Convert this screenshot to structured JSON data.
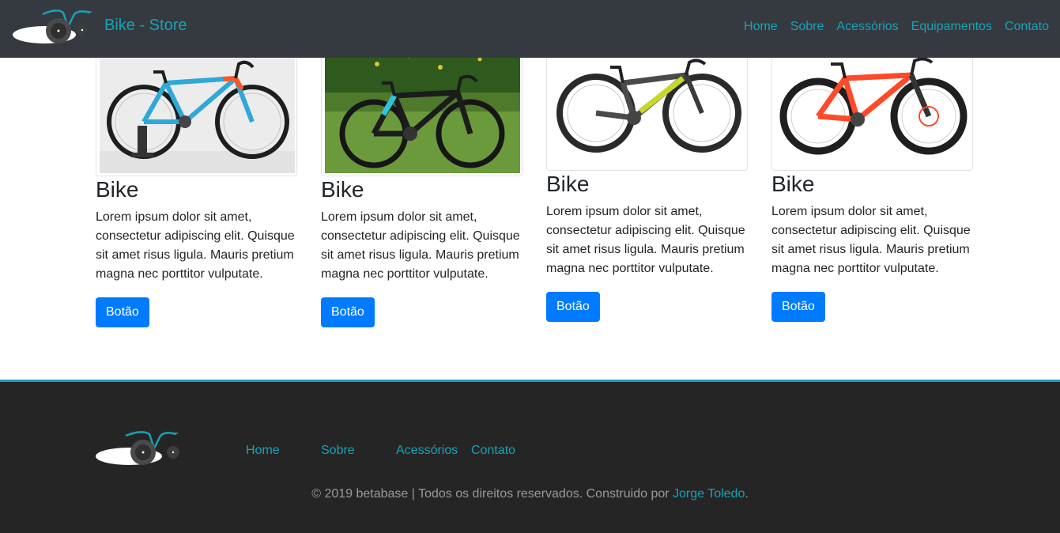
{
  "header": {
    "brand": "Bike - Store",
    "nav": [
      "Home",
      "Sobre",
      "Acessórios",
      "Equipamentos",
      "Contato"
    ]
  },
  "products": [
    {
      "title": "Bike",
      "description": "Lorem ipsum dolor sit amet, consectetur adipiscing elit. Quisque sit amet risus ligula. Mauris pretium magna nec porttitor vulputate.",
      "button": "Botão"
    },
    {
      "title": "Bike",
      "description": "Lorem ipsum dolor sit amet, consectetur adipiscing elit. Quisque sit amet risus ligula. Mauris pretium magna nec porttitor vulputate.",
      "button": "Botão"
    },
    {
      "title": "Bike",
      "description": "Lorem ipsum dolor sit amet, consectetur adipiscing elit. Quisque sit amet risus ligula. Mauris pretium magna nec porttitor vulputate.",
      "button": "Botão"
    },
    {
      "title": "Bike",
      "description": "Lorem ipsum dolor sit amet, consectetur adipiscing elit. Quisque sit amet risus ligula. Mauris pretium magna nec porttitor vulputate.",
      "button": "Botão"
    }
  ],
  "footer": {
    "nav": [
      "Home",
      "Sobre",
      "Acessórios",
      "Contato"
    ],
    "copyright_prefix": "© 2019 betabase | Todos os direitos reservados. Construido por ",
    "author": "Jorge Toledo",
    "copyright_suffix": "."
  },
  "colors": {
    "navbar_bg": "#343a40",
    "accent": "#17a2b8",
    "button": "#007bff",
    "footer_bg": "#252525"
  }
}
